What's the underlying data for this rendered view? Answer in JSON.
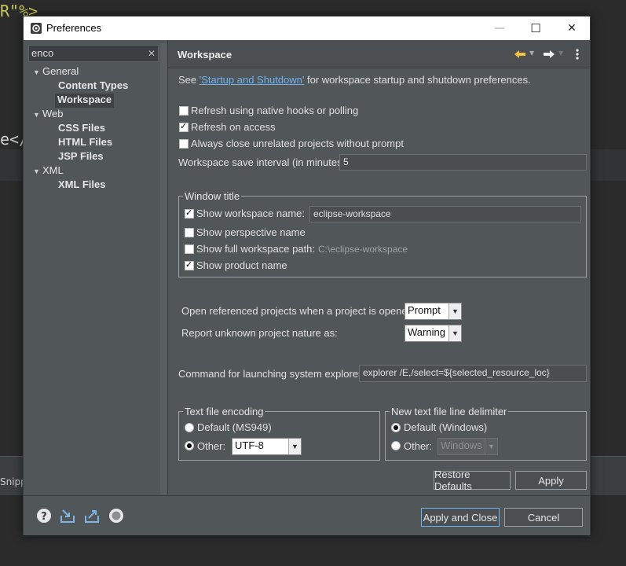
{
  "background": {
    "code_top": "R\"%>",
    "code_mid": "e</",
    "tab_snippet": "Snipp"
  },
  "dialog": {
    "title": "Preferences",
    "window_buttons": {
      "minimize": "—",
      "maximize": "☐",
      "close": "✕"
    }
  },
  "sidebar": {
    "filter_value": "enco",
    "filter_clear": "✕",
    "tree": [
      {
        "label": "General",
        "level": 0,
        "expanded": true
      },
      {
        "label": "Content Types",
        "level": 1
      },
      {
        "label": "Workspace",
        "level": 1,
        "selected": true
      },
      {
        "label": "Web",
        "level": 0,
        "expanded": true
      },
      {
        "label": "CSS Files",
        "level": 1
      },
      {
        "label": "HTML Files",
        "level": 1
      },
      {
        "label": "JSP Files",
        "level": 1
      },
      {
        "label": "XML",
        "level": 0,
        "expanded": true
      },
      {
        "label": "XML Files",
        "level": 1
      }
    ]
  },
  "page": {
    "title": "Workspace",
    "intro_prefix": "See ",
    "intro_link": "'Startup and Shutdown'",
    "intro_suffix": " for workspace startup and shutdown preferences.",
    "options": {
      "refresh_native": {
        "label": "Refresh using native hooks or polling",
        "checked": false
      },
      "refresh_access": {
        "label": "Refresh on access",
        "checked": true
      },
      "always_close": {
        "label": "Always close unrelated projects without prompt",
        "checked": false
      }
    },
    "save_interval_label": "Workspace save interval (in minutes):",
    "save_interval_value": "5",
    "window_title": {
      "legend": "Window title",
      "show_workspace_name": {
        "label": "Show workspace name:",
        "checked": true,
        "value": "eclipse-workspace"
      },
      "show_perspective_name": {
        "label": "Show perspective name",
        "checked": false
      },
      "show_full_path": {
        "label": "Show full workspace path:",
        "checked": false,
        "value": "C:\\eclipse-workspace"
      },
      "show_product_name": {
        "label": "Show product name",
        "checked": true
      }
    },
    "open_referenced_label": "Open referenced projects when a project is opened:",
    "open_referenced_value": "Prompt",
    "report_unknown_label": "Report unknown project nature as:",
    "report_unknown_value": "Warning",
    "explorer_label": "Command for launching system explorer:",
    "explorer_value": "explorer /E,/select=${selected_resource_loc}",
    "encoding": {
      "legend": "Text file encoding",
      "default_label": "Default (MS949)",
      "other_label": "Other:",
      "other_value": "UTF-8",
      "selected": "other"
    },
    "line_delimiter": {
      "legend": "New text file line delimiter",
      "default_label": "Default (Windows)",
      "other_label": "Other:",
      "other_value": "Windows",
      "selected": "default"
    },
    "restore_defaults": "Restore Defaults",
    "apply": "Apply"
  },
  "footer": {
    "apply_and_close": "Apply and Close",
    "cancel": "Cancel",
    "icons": [
      "help-icon",
      "import-icon",
      "export-icon",
      "oomph-icon"
    ]
  },
  "colors": {
    "dialog_bg": "#515658",
    "link": "#6fb3f2",
    "nav_arrow": "#f0c040"
  }
}
